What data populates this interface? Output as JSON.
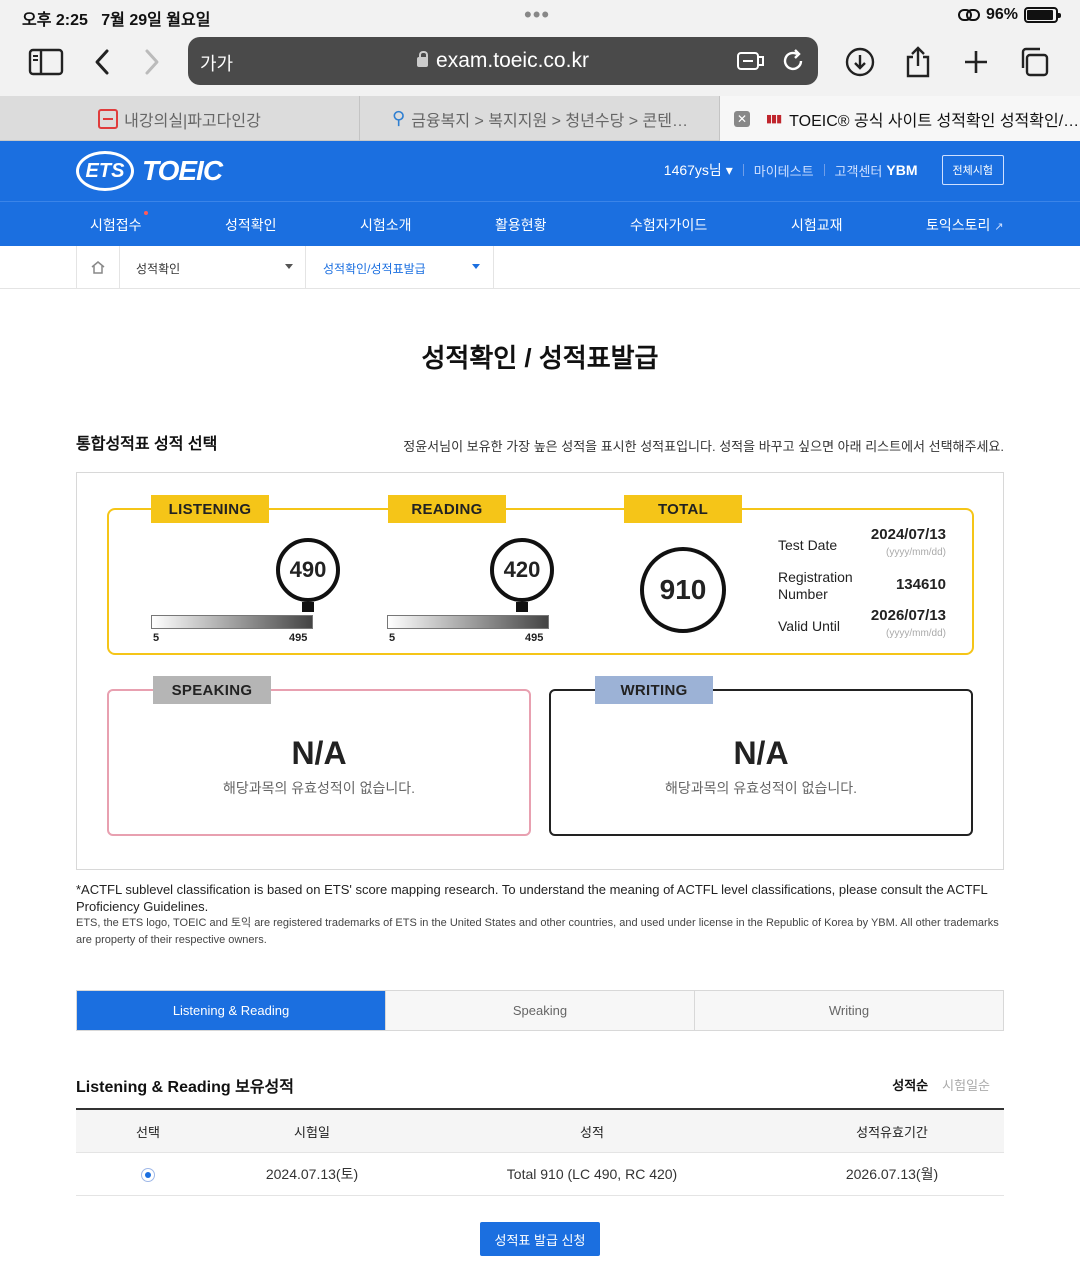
{
  "status_bar": {
    "time": "오후 2:25",
    "date": "7월 29일 월요일",
    "battery": "96%"
  },
  "browser": {
    "aa_label": "가가",
    "url": "exam.toeic.co.kr",
    "tabs": [
      {
        "title": "내강의실|파고다인강"
      },
      {
        "title": "금융복지 > 복지지원 > 청년수당 > 콘텐…"
      },
      {
        "title": "TOEIC® 공식 사이트 성적확인 성적확인/…",
        "active": true
      }
    ]
  },
  "header": {
    "logo_ets": "ETS",
    "logo_toeic": "TOEIC",
    "user": "1467ys님",
    "links": [
      "마이테스트",
      "고객센터"
    ],
    "ybm": "YBM",
    "all_tests": "전체시험"
  },
  "gnb": [
    "시험접수",
    "성적확인",
    "시험소개",
    "활용현황",
    "수험자가이드",
    "시험교재",
    "토익스토리"
  ],
  "breadcrumb": {
    "level1": "성적확인",
    "level2": "성적확인/성적표발급"
  },
  "page_title": "성적확인 / 성적표발급",
  "section": {
    "title": "통합성적표 성적 선택",
    "desc": "정윤서님이 보유한 가장 높은 성적을 표시한 성적표입니다. 성적을 바꾸고 싶으면 아래 리스트에서 선택해주세요."
  },
  "scores": {
    "listening": {
      "label": "LISTENING",
      "score": "490",
      "min": "5",
      "max": "495"
    },
    "reading": {
      "label": "READING",
      "score": "420",
      "min": "5",
      "max": "495"
    },
    "total": {
      "label": "TOTAL",
      "score": "910"
    },
    "test_date": {
      "label": "Test Date",
      "value": "2024/07/13",
      "format": "(yyyy/mm/dd)"
    },
    "registration": {
      "label_1": "Registration",
      "label_2": "Number",
      "value": "134610"
    },
    "valid_until": {
      "label": "Valid Until",
      "value": "2026/07/13",
      "format": "(yyyy/mm/dd)"
    },
    "speaking": {
      "label": "SPEAKING",
      "value": "N/A",
      "msg": "해당과목의 유효성적이 없습니다."
    },
    "writing": {
      "label": "WRITING",
      "value": "N/A",
      "msg": "해당과목의 유효성적이 없습니다."
    }
  },
  "notes": {
    "actfl": "*ACTFL sublevel classification is based on ETS' score mapping research. To understand the meaning of ACTFL level classifications, please consult the ACTFL Proficiency Guidelines.",
    "trademark": "ETS, the ETS logo, TOEIC and 토익 are registered trademarks of ETS in the United States and other countries, and used under license in the Republic of Korea by YBM. All other trademarks are property of their respective owners."
  },
  "subtabs": [
    "Listening & Reading",
    "Speaking",
    "Writing"
  ],
  "list": {
    "title": "Listening & Reading 보유성적",
    "sort_on": "성적순",
    "sort_off": "시험일순",
    "columns": [
      "선택",
      "시험일",
      "성적",
      "성적유효기간"
    ],
    "rows": [
      {
        "date": "2024.07.13(토)",
        "score": "Total 910 (LC 490, RC 420)",
        "valid": "2026.07.13(월)"
      }
    ]
  },
  "issue_button": "성적표 발급 신청",
  "colors": {
    "brand_blue": "#1b6fe0",
    "yellow": "#f5c518",
    "speaking_border": "#e8a0b0"
  }
}
